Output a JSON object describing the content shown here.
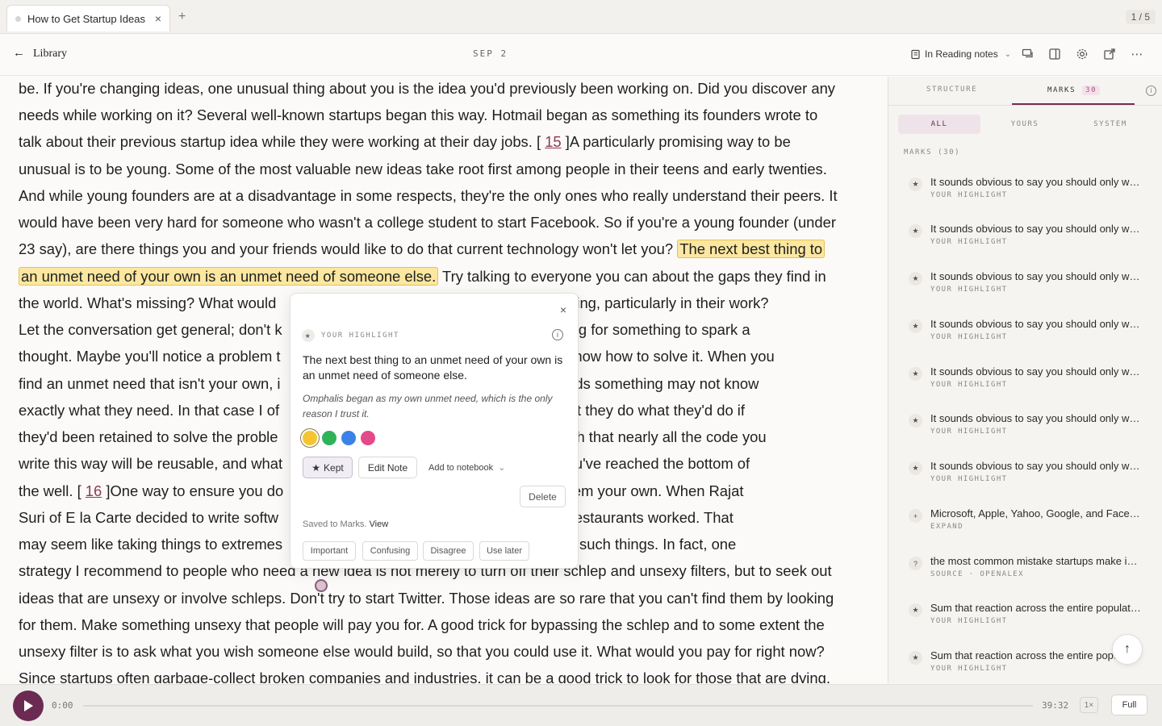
{
  "tabs": [
    {
      "title": "How to Get Startup Ideas",
      "close": "×"
    }
  ],
  "new_tab": "+",
  "page_count": "1 / 5",
  "header": {
    "back_arrow": "←",
    "back_label": "Library",
    "date": "SEP 2",
    "notes_mode": "In Reading notes",
    "icons": [
      "notebook-icon",
      "comments-icon",
      "split-view-icon",
      "gear-icon",
      "external-link-icon",
      "more-icon"
    ]
  },
  "reading": {
    "lines": [
      {
        "parts": [
          {
            "t": "be. If you're changing ideas, one unusual thing about you is the idea you'd previously been working on. Did you discover any"
          }
        ]
      },
      {
        "parts": [
          {
            "t": "needs while working on it? Several well-known startups began this way. Hotmail began as something its founders wrote to"
          }
        ]
      },
      {
        "parts": [
          {
            "t": "talk about their previous startup idea while they were working at their day jobs. [ "
          },
          {
            "t": "15",
            "c": "ref"
          },
          {
            "t": " ]A particularly promising way to be"
          }
        ]
      },
      {
        "parts": [
          {
            "t": "unusual is to be young. Some of the most valuable new ideas take root first among people in their teens and early twenties."
          }
        ]
      },
      {
        "parts": [
          {
            "t": "And while young founders are at a disadvantage in some respects, they're the only ones who really understand their peers. It"
          }
        ]
      },
      {
        "parts": [
          {
            "t": "would have been very hard for someone who wasn't a college student to start Facebook. So if you're a young founder (under"
          }
        ]
      },
      {
        "parts": [
          {
            "t": "23 say), are there things you and your friends would like to do that current technology won't let you? "
          },
          {
            "t": "The next best thing to",
            "c": "hl"
          }
        ]
      },
      {
        "parts": [
          {
            "t": "an unmet need of your own is an unmet need of someone else.",
            "c": "hl"
          },
          {
            "t": " Try talking to everyone you can about the gaps they find in"
          }
        ]
      },
      {
        "parts": [
          {
            "t": "the world. What's missing? What would                                                    ous or annoying, particularly in their work?"
          }
        ]
      },
      {
        "parts": [
          {
            "t": "Let the conversation get general; don't k                                                   're just looking for something to spark a"
          }
        ]
      },
      {
        "parts": [
          {
            "t": "thought. Maybe you'll notice a problem t                                                    cause you know how to solve it. When you"
          }
        ]
      },
      {
        "parts": [
          {
            "t": "find an unmet need that isn't your own, i                                                   son who needs something may not know"
          }
        ]
      },
      {
        "parts": [
          {
            "t": "exactly what they need. In that case I of                                                   ultants — that they do what they'd do if"
          }
        ]
      },
      {
        "parts": [
          {
            "t": "they'd been retained to solve the proble                                                   similar enough that nearly all the code you"
          }
        ]
      },
      {
        "parts": [
          {
            "t": "write this way will be reusable, and what                                                  ertain that you've reached the bottom of"
          }
        ]
      },
      {
        "parts": [
          {
            "t": "the well. [ "
          },
          {
            "t": "16",
            "c": "ref"
          },
          {
            "t": " ]One way to ensure you do                                               s is to make them your own. When Rajat"
          }
        ]
      },
      {
        "parts": [
          {
            "t": "Suri of E la Carte decided to write softw                                                  to learn how restaurants worked. That"
          }
        ]
      },
      {
        "parts": [
          {
            "t": "may seem like taking things to extremes                                                    founders do such things. In fact, one"
          }
        ]
      },
      {
        "parts": [
          {
            "t": "strategy I recommend to people who need a new idea is not merely to turn off their schlep and unsexy filters, but to seek out"
          }
        ]
      },
      {
        "parts": [
          {
            "t": "ideas that are unsexy or involve schleps. Don't try to start Twitter. Those ideas are so rare that you can't find them by looking"
          }
        ]
      },
      {
        "parts": [
          {
            "t": "for them. Make something unsexy that people will pay you for. A good trick for bypassing the schlep and to some extent the"
          }
        ]
      },
      {
        "parts": [
          {
            "t": "unsexy filter is to ask what you wish someone else would build, so that you could use it. What would you pay for right now?"
          }
        ]
      },
      {
        "parts": [
          {
            "t": "Since startups often garbage-collect broken companies and industries, it can be a good trick to look for those that are dying,"
          }
        ]
      }
    ]
  },
  "popup": {
    "close": "×",
    "kind": "YOUR HIGHLIGHT",
    "quote": "The next best thing to an unmet need of your own is an unmet need of someone else.",
    "note": "Omphalis began as my own unmet need, which is the only reason I trust it.",
    "colors": [
      "#f5c531",
      "#2fb35a",
      "#3b82e6",
      "#e24a8a"
    ],
    "selected_color": 0,
    "kept_label": "Kept",
    "edit_label": "Edit Note",
    "add_notebook_label": "Add to notebook",
    "delete_label": "Delete",
    "saved_prefix": "Saved to Marks.",
    "saved_link": "View",
    "tags": [
      "Important",
      "Confusing",
      "Disagree",
      "Use later"
    ]
  },
  "sidebar": {
    "tabs": [
      "STRUCTURE",
      "MARKS"
    ],
    "marks_badge": "30",
    "filters": [
      "ALL",
      "YOURS",
      "SYSTEM"
    ],
    "count_label": "MARKS (30)",
    "marks": [
      {
        "icon": "★",
        "text": "It sounds obvious to say you should only work on problems that exist.",
        "sub": "YOUR HIGHLIGHT"
      },
      {
        "icon": "★",
        "text": "It sounds obvious to say you should only work on problems that exist.",
        "sub": "YOUR HIGHLIGHT"
      },
      {
        "icon": "★",
        "text": "It sounds obvious to say you should only work on problems that exist.",
        "sub": "YOUR HIGHLIGHT"
      },
      {
        "icon": "★",
        "text": "It sounds obvious to say you should only work on problems that exist.",
        "sub": "YOUR HIGHLIGHT"
      },
      {
        "icon": "★",
        "text": "It sounds obvious to say you should only work on problems that exist.",
        "sub": "YOUR HIGHLIGHT"
      },
      {
        "icon": "★",
        "text": "It sounds obvious to say you should only work on problems that exist.",
        "sub": "YOUR HIGHLIGHT"
      },
      {
        "icon": "★",
        "text": "It sounds obvious to say you should only work on problems that exist.",
        "sub": "YOUR HIGHLIGHT"
      },
      {
        "icon": "+",
        "text": "Microsoft, Apple, Yahoo, Google, and Facebook all started this way.",
        "sub": "EXPAND"
      },
      {
        "icon": "?",
        "text": "the most common mistake startups make is to solve problems no one has.",
        "sub": "SOURCE · OPENALEX"
      },
      {
        "icon": "★",
        "text": "Sum that reaction across the entire population of users.",
        "sub": "YOUR HIGHLIGHT"
      },
      {
        "icon": "★",
        "text": "Sum that reaction across the entire population of users.",
        "sub": "YOUR HIGHLIGHT"
      }
    ]
  },
  "player": {
    "current_time": "0:00",
    "duration": "39:32",
    "speed": "1×",
    "full_label": "Full",
    "progress": 0
  }
}
